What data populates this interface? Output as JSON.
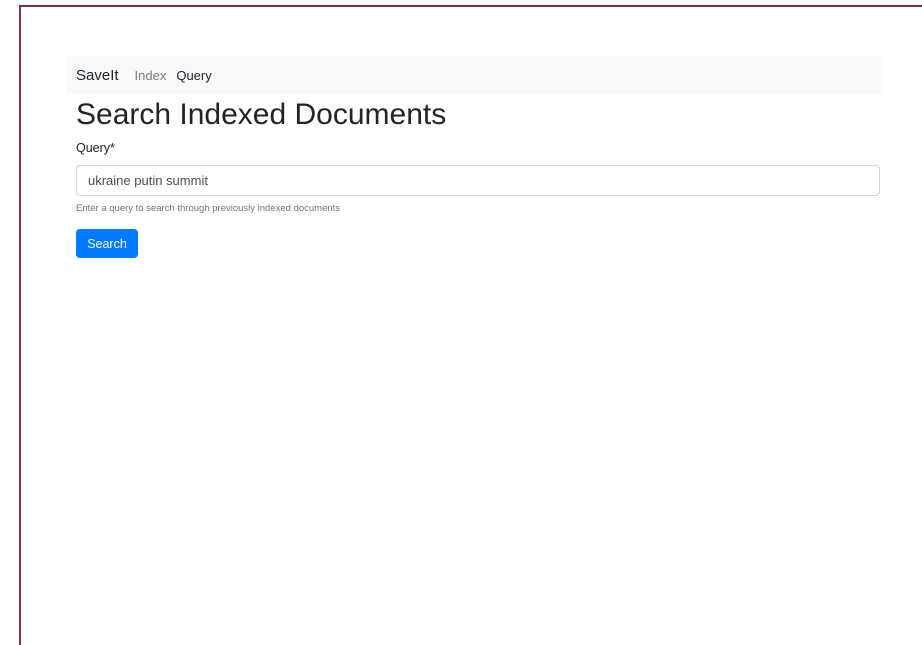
{
  "navbar": {
    "brand": "SaveIt",
    "links": [
      {
        "label": "Index",
        "active": false
      },
      {
        "label": "Query",
        "active": true
      }
    ]
  },
  "main": {
    "title": "Search Indexed Documents",
    "query_label": "Query*",
    "query_value": "ukraine putin summit",
    "help_text": "Enter a query to search through previously indexed documents",
    "search_button": "Search"
  },
  "colors": {
    "frame_border": "#7a2e5c",
    "navbar_bg": "#f8f9fa",
    "primary": "#007bff"
  }
}
